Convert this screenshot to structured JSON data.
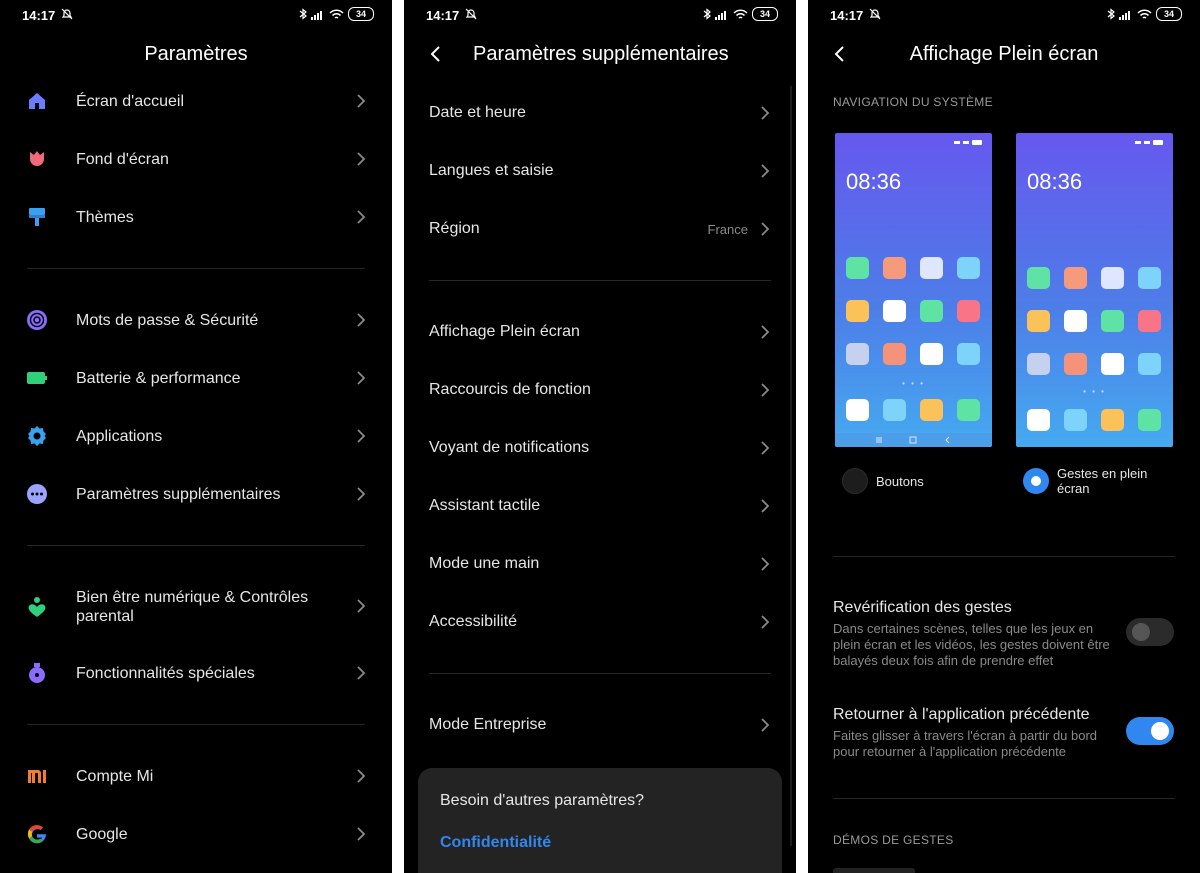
{
  "status": {
    "time": "14:17",
    "battery": "34"
  },
  "panel1": {
    "title": "Paramètres",
    "items": [
      {
        "label": "Écran d'accueil",
        "icon": "home-icon",
        "color": "#6b7cff"
      },
      {
        "label": "Fond d'écran",
        "icon": "tulip-icon",
        "color": "#f06a7c"
      },
      {
        "label": "Thèmes",
        "icon": "paint-roller-icon",
        "color": "#3aa0f0"
      },
      {
        "label": "Mots de passe & Sécurité",
        "icon": "fingerprint-icon",
        "color": "#8c6cff"
      },
      {
        "label": "Batterie & performance",
        "icon": "battery-icon",
        "color": "#2fd07a"
      },
      {
        "label": "Applications",
        "icon": "gear-icon",
        "color": "#3aa0f0"
      },
      {
        "label": "Paramètres supplémentaires",
        "icon": "more-dots-icon",
        "color": "#9aa4ff"
      },
      {
        "label": "Bien être numérique & Contrôles parental",
        "icon": "wellbeing-icon",
        "color": "#2fd07a"
      },
      {
        "label": "Fonctionnalités spéciales",
        "icon": "potion-icon",
        "color": "#8c6cff"
      },
      {
        "label": "Compte Mi",
        "icon": "mi-logo-icon",
        "color": "#f57b2f"
      },
      {
        "label": "Google",
        "icon": "google-icon",
        "color": "#4285f4"
      }
    ]
  },
  "panel2": {
    "title": "Paramètres supplémentaires",
    "items": [
      {
        "label": "Date et heure"
      },
      {
        "label": "Langues et saisie"
      },
      {
        "label": "Région",
        "value": "France"
      },
      {
        "label": "Affichage Plein écran"
      },
      {
        "label": "Raccourcis de fonction"
      },
      {
        "label": "Voyant de notifications"
      },
      {
        "label": "Assistant tactile"
      },
      {
        "label": "Mode une main"
      },
      {
        "label": "Accessibilité"
      },
      {
        "label": "Mode Entreprise"
      }
    ],
    "sheet": {
      "question": "Besoin d'autres paramètres?",
      "link": "Confidentialité"
    }
  },
  "panel3": {
    "title": "Affichage Plein écran",
    "section_nav": "NAVIGATION DU SYSTÈME",
    "preview_time": "08:36",
    "option_buttons": "Boutons",
    "option_gestures": "Gestes en plein écran",
    "selected_option": "Gestes en plein écran",
    "settings": [
      {
        "title": "Revérification des gestes",
        "desc": "Dans certaines scènes, telles que les jeux en plein écran et les vidéos, les gestes doivent être balayés deux fois afin de prendre effet",
        "on": false
      },
      {
        "title": "Retourner à l'application précédente",
        "desc": "Faites glisser à travers l'écran à partir du bord pour retourner à l'application précédente",
        "on": true
      }
    ],
    "section_demos": "DÉMOS DE GESTES"
  },
  "colors": {
    "accent": "#2f87ef",
    "background": "#000000",
    "text": "#e6e6e6",
    "secondary_text": "#8a8a8a"
  }
}
